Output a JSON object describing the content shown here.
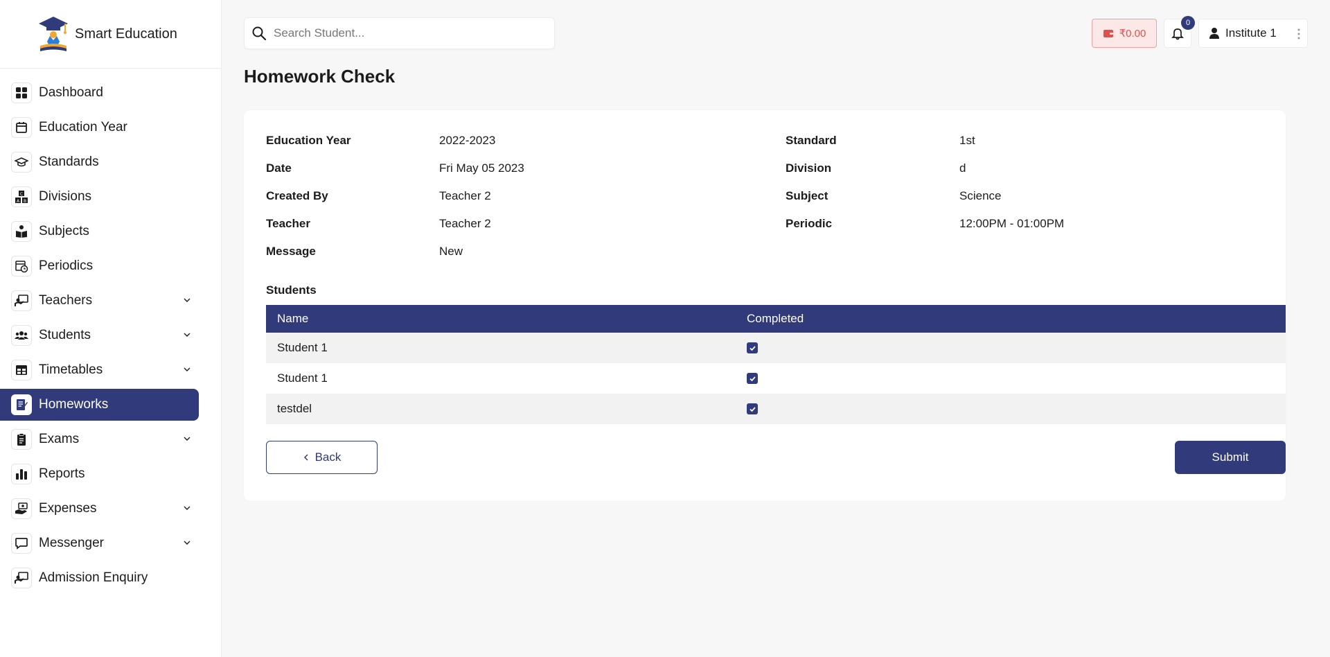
{
  "brand": {
    "name": "Smart Education"
  },
  "sidebar": {
    "items": [
      {
        "label": "Dashboard",
        "icon": "dashboard-icon",
        "has_submenu": false,
        "active": false
      },
      {
        "label": "Education Year",
        "icon": "calendar-icon",
        "has_submenu": false,
        "active": false
      },
      {
        "label": "Standards",
        "icon": "graduation-cap-icon",
        "has_submenu": false,
        "active": false
      },
      {
        "label": "Divisions",
        "icon": "abc-blocks-icon",
        "has_submenu": false,
        "active": false
      },
      {
        "label": "Subjects",
        "icon": "book-reader-icon",
        "has_submenu": false,
        "active": false
      },
      {
        "label": "Periodics",
        "icon": "calendar-clock-icon",
        "has_submenu": false,
        "active": false
      },
      {
        "label": "Teachers",
        "icon": "teacher-board-icon",
        "has_submenu": true,
        "active": false
      },
      {
        "label": "Students",
        "icon": "users-icon",
        "has_submenu": true,
        "active": false
      },
      {
        "label": "Timetables",
        "icon": "table-icon",
        "has_submenu": true,
        "active": false
      },
      {
        "label": "Homeworks",
        "icon": "homework-icon",
        "has_submenu": false,
        "active": true
      },
      {
        "label": "Exams",
        "icon": "clipboard-icon",
        "has_submenu": true,
        "active": false
      },
      {
        "label": "Reports",
        "icon": "bar-chart-icon",
        "has_submenu": false,
        "active": false
      },
      {
        "label": "Expenses",
        "icon": "money-hand-icon",
        "has_submenu": true,
        "active": false
      },
      {
        "label": "Messenger",
        "icon": "message-icon",
        "has_submenu": true,
        "active": false
      },
      {
        "label": "Admission Enquiry",
        "icon": "teacher-board-icon",
        "has_submenu": false,
        "active": false
      }
    ]
  },
  "search": {
    "placeholder": "Search Student..."
  },
  "header": {
    "wallet_amount": "₹0.00",
    "notification_count": "0",
    "user_name": "Institute 1"
  },
  "page": {
    "title": "Homework Check"
  },
  "details": {
    "left": [
      {
        "label": "Education Year",
        "value": "2022-2023"
      },
      {
        "label": "Date",
        "value": "Fri May 05 2023"
      },
      {
        "label": "Created By",
        "value": "Teacher 2"
      },
      {
        "label": "Teacher",
        "value": "Teacher 2"
      },
      {
        "label": "Message",
        "value": "New"
      }
    ],
    "right": [
      {
        "label": "Standard",
        "value": "1st"
      },
      {
        "label": "Division",
        "value": "d"
      },
      {
        "label": "Subject",
        "value": "Science"
      },
      {
        "label": "Periodic",
        "value": "12:00PM - 01:00PM"
      }
    ]
  },
  "students": {
    "title": "Students",
    "columns": [
      "Name",
      "Completed"
    ],
    "rows": [
      {
        "name": "Student 1",
        "completed": true
      },
      {
        "name": "Student 1",
        "completed": true
      },
      {
        "name": "testdel",
        "completed": true
      }
    ]
  },
  "actions": {
    "back_label": "Back",
    "submit_label": "Submit"
  },
  "colors": {
    "primary": "#313a7a",
    "wallet_text": "#e0504f",
    "wallet_bg": "#fde8e8"
  }
}
